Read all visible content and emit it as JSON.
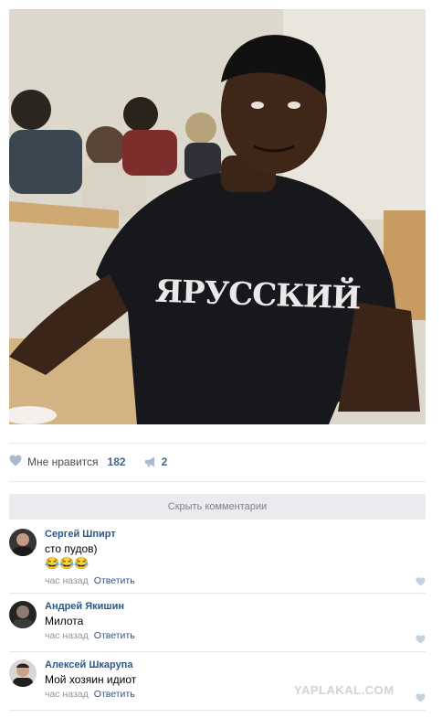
{
  "post": {
    "photo_print": "ЯРУССКИЙ",
    "likes_label": "Мне нравится",
    "likes_count": "182",
    "shares_count": "2"
  },
  "comments_toggle": "Скрыть комментарии",
  "comments": [
    {
      "author": "Сергей Шпирт",
      "text": "сто пудов)",
      "emoji": [
        "😂",
        "😂",
        "😂"
      ],
      "time": "час назад",
      "reply": "Ответить"
    },
    {
      "author": "Андрей Якишин",
      "text": "Милота",
      "time": "час назад",
      "reply": "Ответить"
    },
    {
      "author": "Алексей Шкарупа",
      "text": "Мой хозяин идиот",
      "time": "час назад",
      "reply": "Ответить"
    }
  ],
  "watermark": "YAPLAKAL.COM",
  "icons": {
    "like": "heart-icon",
    "share": "megaphone-icon",
    "comment_like": "heart-icon"
  },
  "colors": {
    "link": "#2a5885",
    "muted": "#939393",
    "bar": "#e9ebee",
    "icon": "#aab9cc"
  }
}
